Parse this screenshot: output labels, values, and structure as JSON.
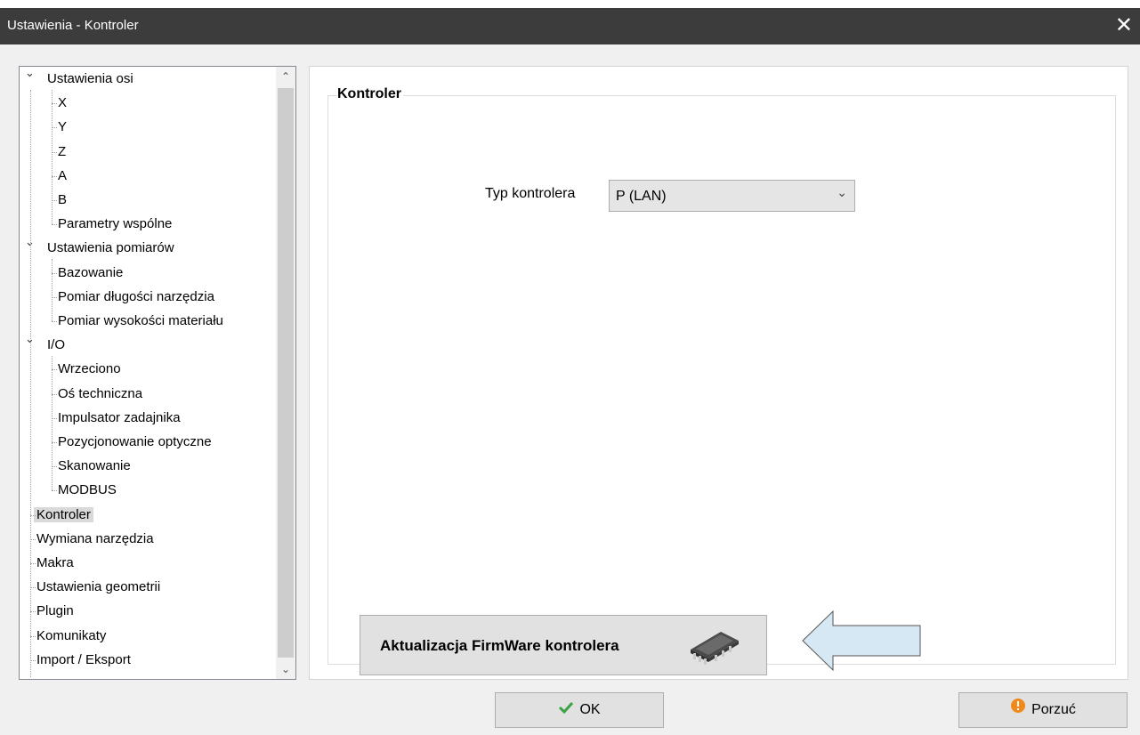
{
  "window": {
    "title": "Ustawienia - Kontroler",
    "close_glyph": "✕"
  },
  "tree": {
    "items": [
      {
        "label": "Ustawienia osi",
        "level": 0,
        "expandable": true
      },
      {
        "label": "X",
        "level": 1
      },
      {
        "label": "Y",
        "level": 1
      },
      {
        "label": "Z",
        "level": 1
      },
      {
        "label": "A",
        "level": 1
      },
      {
        "label": "B",
        "level": 1
      },
      {
        "label": "Parametry wspólne",
        "level": 1
      },
      {
        "label": "Ustawienia pomiarów",
        "level": 0,
        "expandable": true
      },
      {
        "label": "Bazowanie",
        "level": 1
      },
      {
        "label": "Pomiar długości narzędzia",
        "level": 1
      },
      {
        "label": "Pomiar wysokości materiału",
        "level": 1
      },
      {
        "label": "I/O",
        "level": 0,
        "expandable": true
      },
      {
        "label": "Wrzeciono",
        "level": 1
      },
      {
        "label": "Oś techniczna",
        "level": 1
      },
      {
        "label": "Impulsator zadajnika",
        "level": 1
      },
      {
        "label": "Pozycjonowanie optyczne",
        "level": 1
      },
      {
        "label": "Skanowanie",
        "level": 1
      },
      {
        "label": "MODBUS",
        "level": 1
      },
      {
        "label": "Kontroler",
        "level": 0,
        "selected": true
      },
      {
        "label": "Wymiana narzędzia",
        "level": 0
      },
      {
        "label": "Makra",
        "level": 0
      },
      {
        "label": "Ustawienia geometrii",
        "level": 0
      },
      {
        "label": "Plugin",
        "level": 0
      },
      {
        "label": "Komunikaty",
        "level": 0
      },
      {
        "label": "Import / Eksport",
        "level": 0
      }
    ]
  },
  "panel": {
    "group_title": "Kontroler",
    "controller_type_label": "Typ kontrolera",
    "controller_type_value": "P (LAN)",
    "firmware_button_label": "Aktualizacja FirmWare kontrolera",
    "firmware_icon": "chip-icon"
  },
  "footer": {
    "ok_label": "OK",
    "cancel_label": "Porzuć"
  },
  "colors": {
    "titlebar": "#3c3c3c",
    "arrow_fill": "#d6e8f3",
    "ok_check": "#3aa346",
    "cancel_icon": "#f08a1c"
  }
}
